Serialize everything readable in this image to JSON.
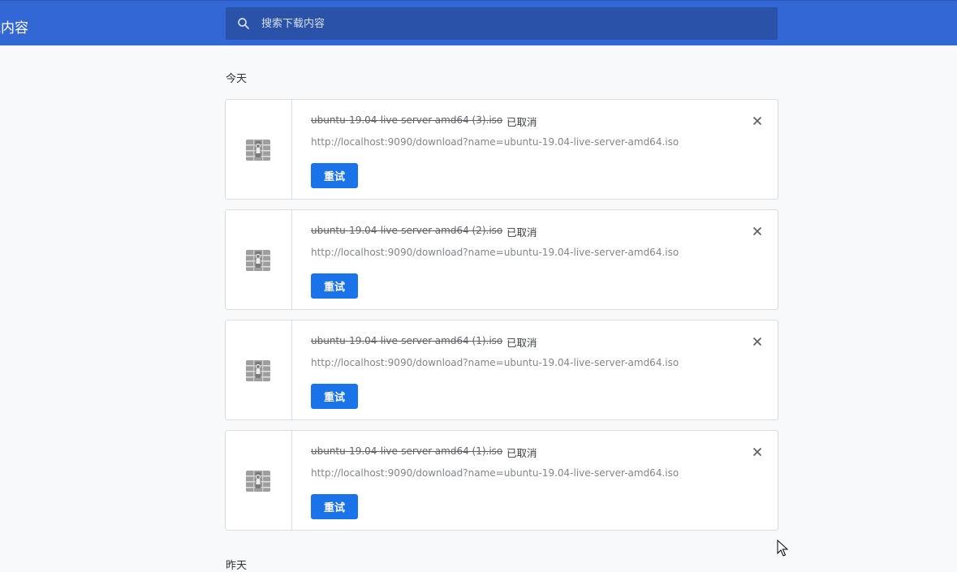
{
  "header": {
    "title": "载内容",
    "search_placeholder": "搜索下载内容",
    "colors": {
      "bar": "#3367d6",
      "search_bg": "#2a52a8"
    }
  },
  "sections": [
    {
      "label": "今天"
    },
    {
      "label": "昨天"
    }
  ],
  "downloads": [
    {
      "file_name": "ubuntu-19.04-live-server-amd64 (3).iso",
      "status": "已取消",
      "url": "http://localhost:9090/download?name=ubuntu-19.04-live-server-amd64.iso",
      "retry_label": "重试",
      "icon": "archive-file-icon"
    },
    {
      "file_name": "ubuntu-19.04-live-server-amd64 (2).iso",
      "status": "已取消",
      "url": "http://localhost:9090/download?name=ubuntu-19.04-live-server-amd64.iso",
      "retry_label": "重试",
      "icon": "archive-file-icon"
    },
    {
      "file_name": "ubuntu-19.04-live-server-amd64 (1).iso",
      "status": "已取消",
      "url": "http://localhost:9090/download?name=ubuntu-19.04-live-server-amd64.iso",
      "retry_label": "重试",
      "icon": "archive-file-icon"
    },
    {
      "file_name": "ubuntu-19.04-live-server-amd64 (1).iso",
      "status": "已取消",
      "url": "http://localhost:9090/download?name=ubuntu-19.04-live-server-amd64.iso",
      "retry_label": "重试",
      "icon": "archive-file-icon"
    }
  ],
  "accent_color": "#1a73e8"
}
